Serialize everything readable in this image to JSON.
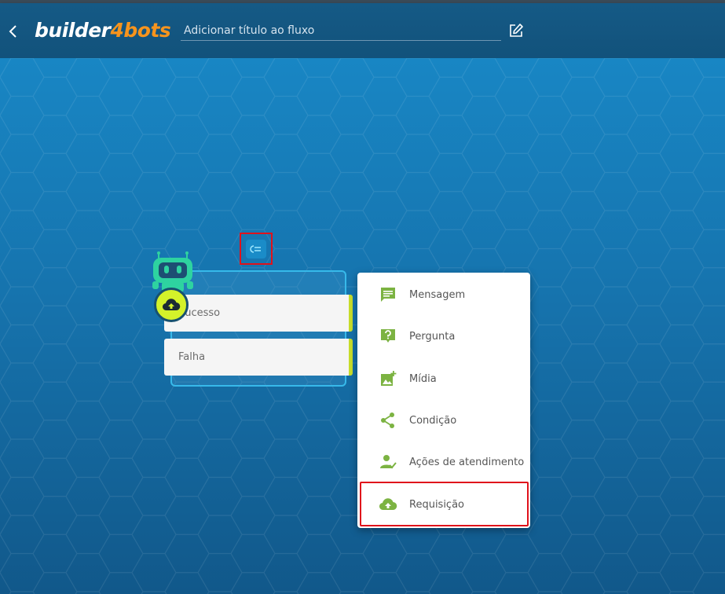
{
  "header": {
    "back_icon": "chevron-left-icon",
    "logo_part1": "builder",
    "logo_part2": "4bots",
    "title_placeholder": "Adicionar título ao fluxo",
    "edit_icon": "pencil-icon"
  },
  "colors": {
    "header_bg": "#155a86",
    "canvas_bg": "#1673ad",
    "accent_orange": "#f7941d",
    "accent_green": "#7cb342",
    "lime": "#d4f22a",
    "highlight_red": "#e0121b"
  },
  "node": {
    "outputs": [
      "Sucesso",
      "Falha"
    ],
    "type_icon": "cloud-upload-icon",
    "bot_icon": "robot-icon",
    "handle_icon": "node-type-icon"
  },
  "menu": {
    "items": [
      {
        "label": "Mensagem",
        "icon": "message-icon"
      },
      {
        "label": "Pergunta",
        "icon": "question-icon"
      },
      {
        "label": "Mídia",
        "icon": "add-image-icon"
      },
      {
        "label": "Condição",
        "icon": "share-icon"
      },
      {
        "label": "Ações de atendimento",
        "icon": "user-check-icon"
      },
      {
        "label": "Requisição",
        "icon": "cloud-upload-icon"
      }
    ]
  }
}
